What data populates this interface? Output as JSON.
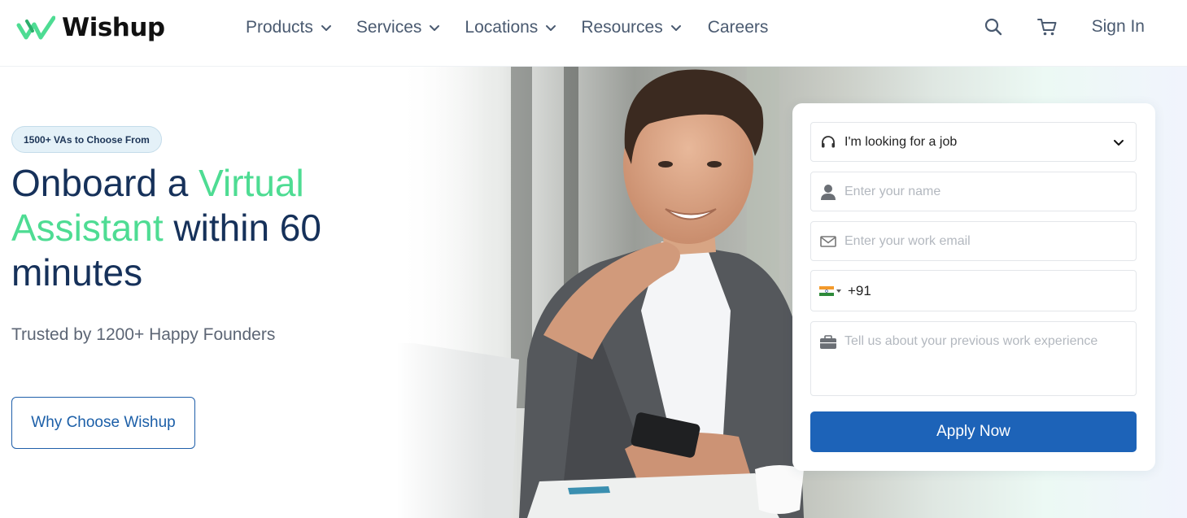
{
  "brand": {
    "name": "Wishup",
    "mark_color": "#4edc93"
  },
  "nav": {
    "items": [
      {
        "label": "Products",
        "has_dropdown": true
      },
      {
        "label": "Services",
        "has_dropdown": true
      },
      {
        "label": "Locations",
        "has_dropdown": true
      },
      {
        "label": "Resources",
        "has_dropdown": true
      }
    ],
    "careers": "Careers",
    "search_icon": "search-icon",
    "cart_icon": "cart-icon",
    "sign_in": "Sign In"
  },
  "hero": {
    "badge": "1500+ VAs to Choose From",
    "headline_part1": "Onboard a ",
    "headline_highlight": "Virtual Assistant",
    "headline_part2": " within 60 minutes",
    "subline": "Trusted by 1200+ Happy Founders",
    "cta": "Why Choose Wishup",
    "highlight_color": "#4edc93",
    "heading_color": "#16315a"
  },
  "form": {
    "role_select": {
      "value": "I'm looking for a job",
      "icon": "headset-icon"
    },
    "name": {
      "placeholder": "Enter your name",
      "icon": "user-icon"
    },
    "email": {
      "placeholder": "Enter your work email",
      "icon": "mail-icon"
    },
    "phone": {
      "country_code": "+91",
      "flag": "india-flag-icon"
    },
    "experience": {
      "placeholder": "Tell us about your previous work experience",
      "icon": "briefcase-icon"
    },
    "submit": "Apply Now",
    "submit_color": "#1d63b8"
  }
}
